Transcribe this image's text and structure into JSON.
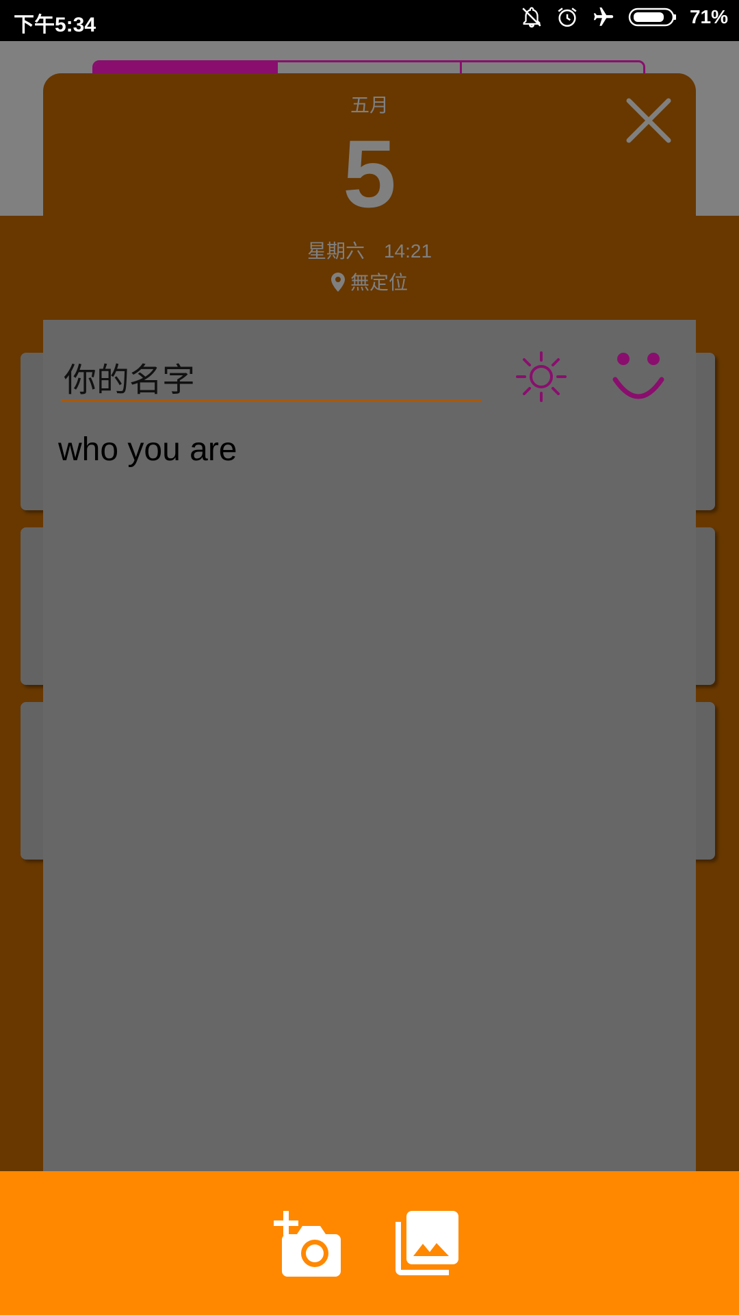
{
  "status_bar": {
    "time": "下午5:34",
    "battery_percent": "71%",
    "icons": [
      "notifications-off-icon",
      "alarm-icon",
      "airplane-mode-icon",
      "battery-icon"
    ]
  },
  "background_app": {
    "tabs": [
      "",
      "",
      ""
    ],
    "active_tab": 0,
    "cards": 3
  },
  "dialog": {
    "month": "五月",
    "day": "5",
    "weekday": "星期六",
    "time": "14:21",
    "location": "無定位",
    "name_field": {
      "value": "你的名字",
      "placeholder": ""
    },
    "note": "who you are",
    "weather_icon": "sun-icon",
    "mood_icon": "smiley-icon"
  },
  "bottom_bar": {
    "buttons": [
      "add-photo-camera-icon",
      "gallery-icon"
    ]
  },
  "colors": {
    "header_bg": "#683800",
    "accent": "#8a0e6e",
    "bottom_bar": "#ff8800",
    "dialog_body": "#676767"
  }
}
